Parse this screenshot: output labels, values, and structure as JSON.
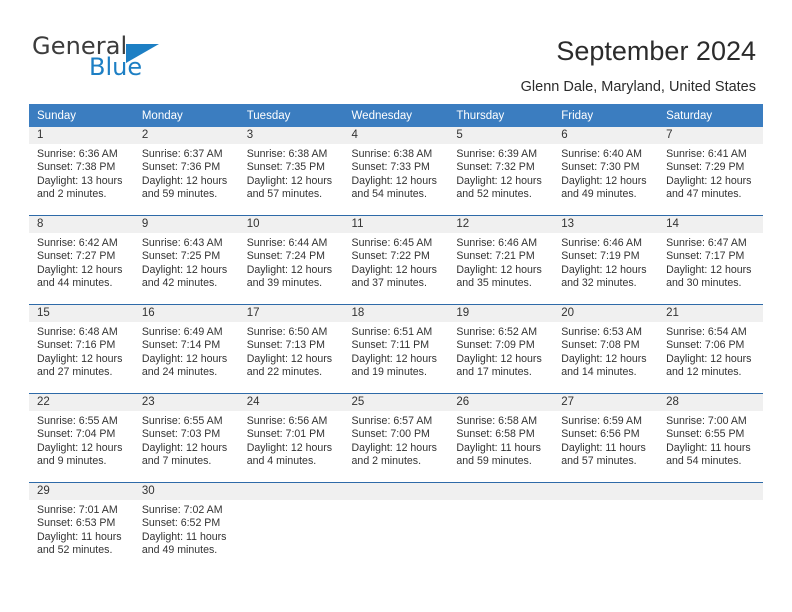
{
  "brand": {
    "name_part1": "General",
    "name_part2": "Blue",
    "triangle_icon": "triangle-icon",
    "accent_color": "#1d7fc4"
  },
  "header": {
    "title": "September 2024",
    "subtitle": "Glenn Dale, Maryland, United States"
  },
  "colors": {
    "header_blue": "#3b7dc0",
    "row_divider_blue": "#2e6aa8",
    "daynum_band": "#f0f0f0",
    "text": "#333333"
  },
  "calendar": {
    "weekday_headers": [
      "Sunday",
      "Monday",
      "Tuesday",
      "Wednesday",
      "Thursday",
      "Friday",
      "Saturday"
    ],
    "weeks": [
      [
        {
          "day": "1",
          "sunrise": "Sunrise: 6:36 AM",
          "sunset": "Sunset: 7:38 PM",
          "daylight1": "Daylight: 13 hours",
          "daylight2": "and 2 minutes."
        },
        {
          "day": "2",
          "sunrise": "Sunrise: 6:37 AM",
          "sunset": "Sunset: 7:36 PM",
          "daylight1": "Daylight: 12 hours",
          "daylight2": "and 59 minutes."
        },
        {
          "day": "3",
          "sunrise": "Sunrise: 6:38 AM",
          "sunset": "Sunset: 7:35 PM",
          "daylight1": "Daylight: 12 hours",
          "daylight2": "and 57 minutes."
        },
        {
          "day": "4",
          "sunrise": "Sunrise: 6:38 AM",
          "sunset": "Sunset: 7:33 PM",
          "daylight1": "Daylight: 12 hours",
          "daylight2": "and 54 minutes."
        },
        {
          "day": "5",
          "sunrise": "Sunrise: 6:39 AM",
          "sunset": "Sunset: 7:32 PM",
          "daylight1": "Daylight: 12 hours",
          "daylight2": "and 52 minutes."
        },
        {
          "day": "6",
          "sunrise": "Sunrise: 6:40 AM",
          "sunset": "Sunset: 7:30 PM",
          "daylight1": "Daylight: 12 hours",
          "daylight2": "and 49 minutes."
        },
        {
          "day": "7",
          "sunrise": "Sunrise: 6:41 AM",
          "sunset": "Sunset: 7:29 PM",
          "daylight1": "Daylight: 12 hours",
          "daylight2": "and 47 minutes."
        }
      ],
      [
        {
          "day": "8",
          "sunrise": "Sunrise: 6:42 AM",
          "sunset": "Sunset: 7:27 PM",
          "daylight1": "Daylight: 12 hours",
          "daylight2": "and 44 minutes."
        },
        {
          "day": "9",
          "sunrise": "Sunrise: 6:43 AM",
          "sunset": "Sunset: 7:25 PM",
          "daylight1": "Daylight: 12 hours",
          "daylight2": "and 42 minutes."
        },
        {
          "day": "10",
          "sunrise": "Sunrise: 6:44 AM",
          "sunset": "Sunset: 7:24 PM",
          "daylight1": "Daylight: 12 hours",
          "daylight2": "and 39 minutes."
        },
        {
          "day": "11",
          "sunrise": "Sunrise: 6:45 AM",
          "sunset": "Sunset: 7:22 PM",
          "daylight1": "Daylight: 12 hours",
          "daylight2": "and 37 minutes."
        },
        {
          "day": "12",
          "sunrise": "Sunrise: 6:46 AM",
          "sunset": "Sunset: 7:21 PM",
          "daylight1": "Daylight: 12 hours",
          "daylight2": "and 35 minutes."
        },
        {
          "day": "13",
          "sunrise": "Sunrise: 6:46 AM",
          "sunset": "Sunset: 7:19 PM",
          "daylight1": "Daylight: 12 hours",
          "daylight2": "and 32 minutes."
        },
        {
          "day": "14",
          "sunrise": "Sunrise: 6:47 AM",
          "sunset": "Sunset: 7:17 PM",
          "daylight1": "Daylight: 12 hours",
          "daylight2": "and 30 minutes."
        }
      ],
      [
        {
          "day": "15",
          "sunrise": "Sunrise: 6:48 AM",
          "sunset": "Sunset: 7:16 PM",
          "daylight1": "Daylight: 12 hours",
          "daylight2": "and 27 minutes."
        },
        {
          "day": "16",
          "sunrise": "Sunrise: 6:49 AM",
          "sunset": "Sunset: 7:14 PM",
          "daylight1": "Daylight: 12 hours",
          "daylight2": "and 24 minutes."
        },
        {
          "day": "17",
          "sunrise": "Sunrise: 6:50 AM",
          "sunset": "Sunset: 7:13 PM",
          "daylight1": "Daylight: 12 hours",
          "daylight2": "and 22 minutes."
        },
        {
          "day": "18",
          "sunrise": "Sunrise: 6:51 AM",
          "sunset": "Sunset: 7:11 PM",
          "daylight1": "Daylight: 12 hours",
          "daylight2": "and 19 minutes."
        },
        {
          "day": "19",
          "sunrise": "Sunrise: 6:52 AM",
          "sunset": "Sunset: 7:09 PM",
          "daylight1": "Daylight: 12 hours",
          "daylight2": "and 17 minutes."
        },
        {
          "day": "20",
          "sunrise": "Sunrise: 6:53 AM",
          "sunset": "Sunset: 7:08 PM",
          "daylight1": "Daylight: 12 hours",
          "daylight2": "and 14 minutes."
        },
        {
          "day": "21",
          "sunrise": "Sunrise: 6:54 AM",
          "sunset": "Sunset: 7:06 PM",
          "daylight1": "Daylight: 12 hours",
          "daylight2": "and 12 minutes."
        }
      ],
      [
        {
          "day": "22",
          "sunrise": "Sunrise: 6:55 AM",
          "sunset": "Sunset: 7:04 PM",
          "daylight1": "Daylight: 12 hours",
          "daylight2": "and 9 minutes."
        },
        {
          "day": "23",
          "sunrise": "Sunrise: 6:55 AM",
          "sunset": "Sunset: 7:03 PM",
          "daylight1": "Daylight: 12 hours",
          "daylight2": "and 7 minutes."
        },
        {
          "day": "24",
          "sunrise": "Sunrise: 6:56 AM",
          "sunset": "Sunset: 7:01 PM",
          "daylight1": "Daylight: 12 hours",
          "daylight2": "and 4 minutes."
        },
        {
          "day": "25",
          "sunrise": "Sunrise: 6:57 AM",
          "sunset": "Sunset: 7:00 PM",
          "daylight1": "Daylight: 12 hours",
          "daylight2": "and 2 minutes."
        },
        {
          "day": "26",
          "sunrise": "Sunrise: 6:58 AM",
          "sunset": "Sunset: 6:58 PM",
          "daylight1": "Daylight: 11 hours",
          "daylight2": "and 59 minutes."
        },
        {
          "day": "27",
          "sunrise": "Sunrise: 6:59 AM",
          "sunset": "Sunset: 6:56 PM",
          "daylight1": "Daylight: 11 hours",
          "daylight2": "and 57 minutes."
        },
        {
          "day": "28",
          "sunrise": "Sunrise: 7:00 AM",
          "sunset": "Sunset: 6:55 PM",
          "daylight1": "Daylight: 11 hours",
          "daylight2": "and 54 minutes."
        }
      ],
      [
        {
          "day": "29",
          "sunrise": "Sunrise: 7:01 AM",
          "sunset": "Sunset: 6:53 PM",
          "daylight1": "Daylight: 11 hours",
          "daylight2": "and 52 minutes."
        },
        {
          "day": "30",
          "sunrise": "Sunrise: 7:02 AM",
          "sunset": "Sunset: 6:52 PM",
          "daylight1": "Daylight: 11 hours",
          "daylight2": "and 49 minutes."
        },
        {
          "day": "",
          "sunrise": "",
          "sunset": "",
          "daylight1": "",
          "daylight2": ""
        },
        {
          "day": "",
          "sunrise": "",
          "sunset": "",
          "daylight1": "",
          "daylight2": ""
        },
        {
          "day": "",
          "sunrise": "",
          "sunset": "",
          "daylight1": "",
          "daylight2": ""
        },
        {
          "day": "",
          "sunrise": "",
          "sunset": "",
          "daylight1": "",
          "daylight2": ""
        },
        {
          "day": "",
          "sunrise": "",
          "sunset": "",
          "daylight1": "",
          "daylight2": ""
        }
      ]
    ]
  }
}
